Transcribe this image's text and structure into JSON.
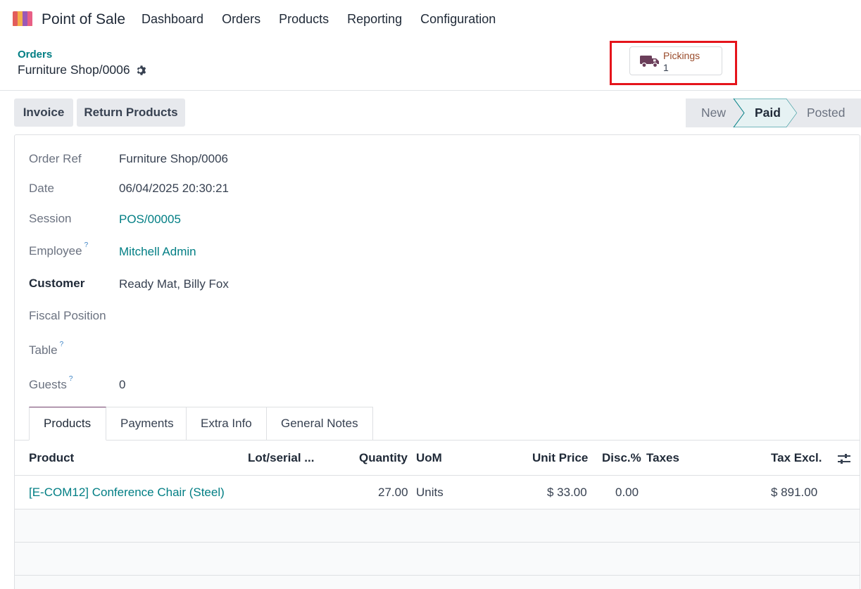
{
  "app": {
    "name": "Point of Sale",
    "menu": [
      "Dashboard",
      "Orders",
      "Products",
      "Reporting",
      "Configuration"
    ]
  },
  "breadcrumb": {
    "parent": "Orders",
    "current": "Furniture Shop/0006"
  },
  "smart_button": {
    "icon": "truck-icon",
    "label": "Pickings",
    "value": "1"
  },
  "actions": {
    "invoice": "Invoice",
    "return_products": "Return Products"
  },
  "statusbar": {
    "states": [
      "New",
      "Paid",
      "Posted"
    ],
    "current": "Paid"
  },
  "fields": {
    "order_ref": {
      "label": "Order Ref",
      "value": "Furniture Shop/0006"
    },
    "date": {
      "label": "Date",
      "value": "06/04/2025 20:30:21"
    },
    "session": {
      "label": "Session",
      "value": "POS/00005"
    },
    "employee": {
      "label": "Employee",
      "help": "?",
      "value": "Mitchell Admin"
    },
    "customer": {
      "label": "Customer",
      "value": "Ready Mat, Billy Fox"
    },
    "fiscal_position": {
      "label": "Fiscal Position",
      "value": ""
    },
    "table": {
      "label": "Table",
      "help": "?",
      "value": ""
    },
    "guests": {
      "label": "Guests",
      "help": "?",
      "value": "0"
    }
  },
  "tabs": [
    "Products",
    "Payments",
    "Extra Info",
    "General Notes"
  ],
  "table": {
    "headers": {
      "product": "Product",
      "lot": "Lot/serial ...",
      "quantity": "Quantity",
      "uom": "UoM",
      "unit_price": "Unit Price",
      "disc": "Disc.%",
      "taxes": "Taxes",
      "tax_excl": "Tax Excl."
    },
    "rows": [
      {
        "product": "[E-COM12] Conference Chair (Steel)",
        "lot": "",
        "quantity": "27.00",
        "uom": "Units",
        "unit_price": "$ 33.00",
        "disc": "0.00",
        "taxes": "",
        "tax_excl": "$ 891.00"
      }
    ]
  },
  "colors": {
    "link": "#017e84",
    "highlight": "#e5141b",
    "tab_active": "#71406a"
  }
}
